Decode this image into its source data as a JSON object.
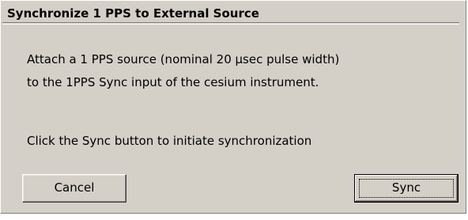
{
  "dialog": {
    "title": "Synchronize 1 PPS to External Source",
    "message_line1": "Attach a 1 PPS source (nominal 20 µsec pulse width)",
    "message_line2": "to the 1PPS Sync input of the cesium instrument.",
    "message_line3": "Click the Sync button to initiate synchronization"
  },
  "buttons": {
    "cancel_label": "Cancel",
    "sync_label": "Sync"
  }
}
